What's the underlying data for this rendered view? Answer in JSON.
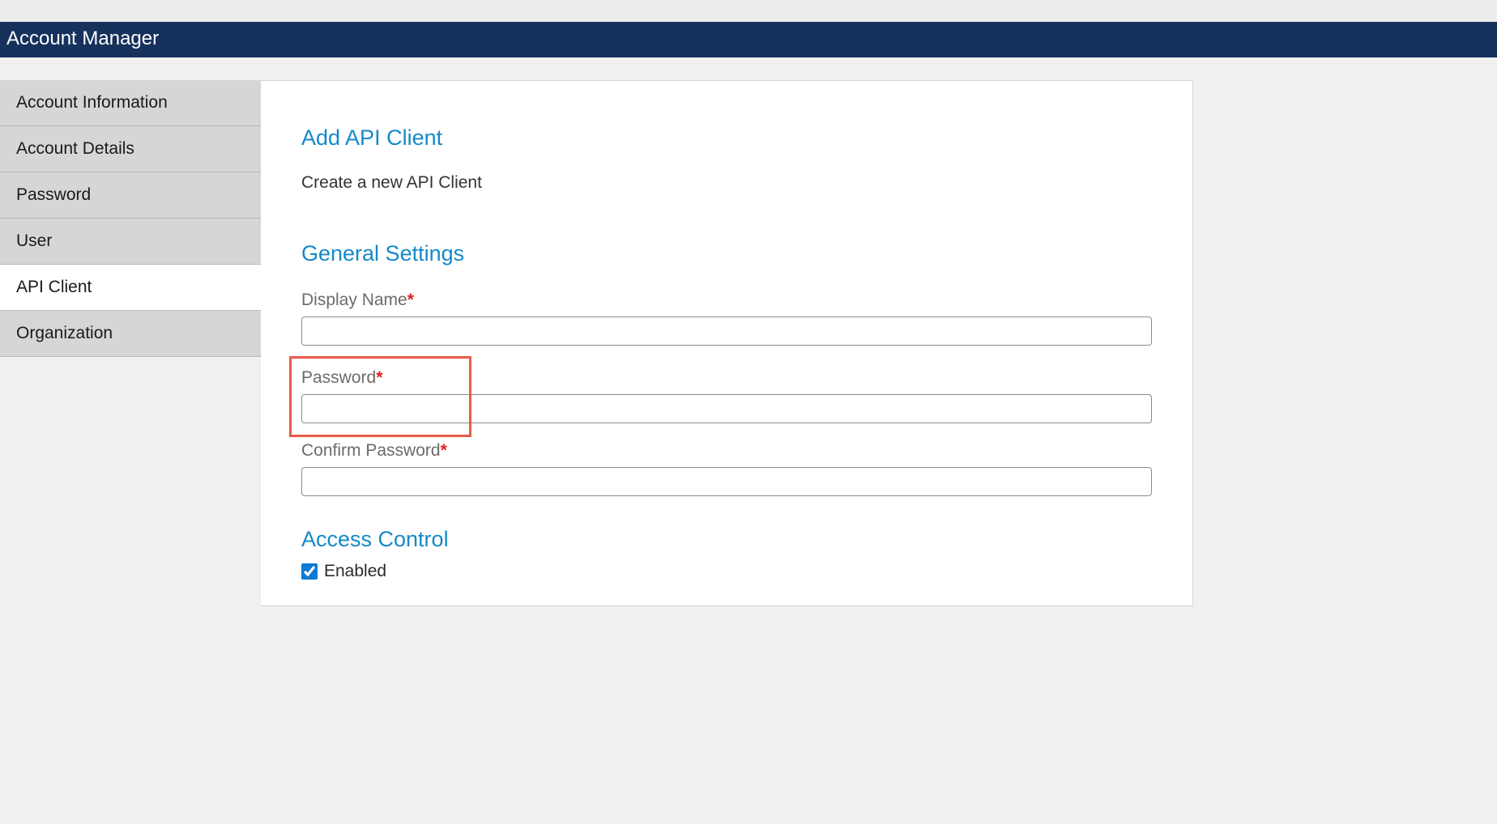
{
  "header": {
    "title": "Account Manager"
  },
  "sidebar": {
    "items": [
      {
        "label": "Account Information",
        "active": false
      },
      {
        "label": "Account Details",
        "active": false
      },
      {
        "label": "Password",
        "active": false
      },
      {
        "label": "User",
        "active": false
      },
      {
        "label": "API Client",
        "active": true
      },
      {
        "label": "Organization",
        "active": false
      }
    ]
  },
  "main": {
    "page_title": "Add API Client",
    "page_subtitle": "Create a new API Client",
    "general_settings_heading": "General Settings",
    "fields": {
      "display_name": {
        "label": "Display Name",
        "required": "*",
        "value": ""
      },
      "password": {
        "label": "Password",
        "required": "*",
        "value": ""
      },
      "confirm_password": {
        "label": "Confirm Password",
        "required": "*",
        "value": ""
      }
    },
    "access_control_heading": "Access Control",
    "enabled_label": "Enabled",
    "enabled_checked": true
  }
}
